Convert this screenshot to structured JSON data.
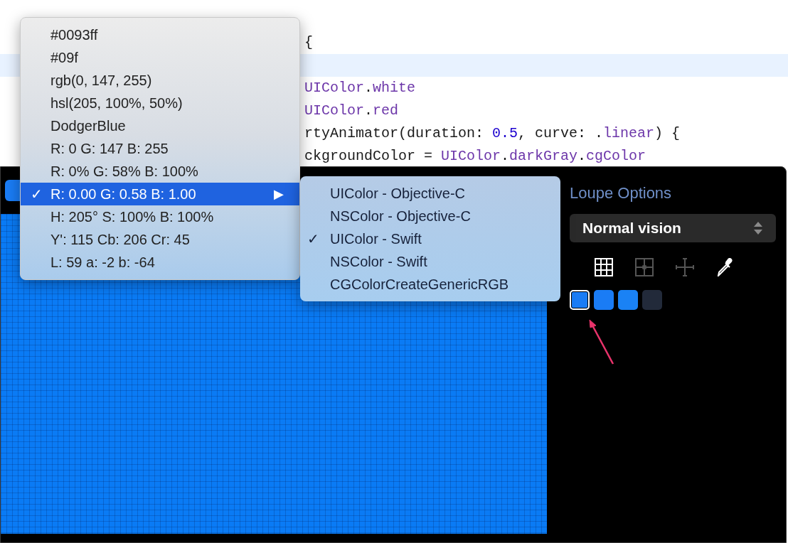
{
  "editor": {
    "lines": [
      {
        "highlighted": false,
        "tokens": [
          {
            "text": "{",
            "kind": "plain"
          }
        ]
      },
      {
        "highlighted": true
      },
      {
        "highlighted": false,
        "tokens": [
          {
            "text": "UIColor",
            "kind": "type"
          },
          {
            "text": ".",
            "kind": "plain"
          },
          {
            "text": "white",
            "kind": "type"
          }
        ]
      },
      {
        "highlighted": false,
        "tokens": [
          {
            "text": "UIColor",
            "kind": "type"
          },
          {
            "text": ".",
            "kind": "plain"
          },
          {
            "text": "red",
            "kind": "type"
          }
        ]
      },
      {
        "highlighted": false,
        "tokens": [
          {
            "text": "rtyAnimator(duration: ",
            "kind": "plain"
          },
          {
            "text": "0.5",
            "kind": "number"
          },
          {
            "text": ", curve: .",
            "kind": "plain"
          },
          {
            "text": "linear",
            "kind": "type"
          },
          {
            "text": ") {",
            "kind": "plain"
          }
        ]
      },
      {
        "highlighted": false,
        "tokens": [
          {
            "text": "ckgroundColor = ",
            "kind": "plain"
          },
          {
            "text": "UIColor",
            "kind": "type"
          },
          {
            "text": ".",
            "kind": "plain"
          },
          {
            "text": "darkGray",
            "kind": "type"
          },
          {
            "text": ".",
            "kind": "plain"
          },
          {
            "text": "cgColor",
            "kind": "type"
          }
        ]
      }
    ]
  },
  "format_menu": {
    "items": [
      {
        "label": "#0093ff",
        "selected": false,
        "submenu": false
      },
      {
        "label": "#09f",
        "selected": false,
        "submenu": false
      },
      {
        "label": "rgb(0, 147, 255)",
        "selected": false,
        "submenu": false
      },
      {
        "label": "hsl(205, 100%, 50%)",
        "selected": false,
        "submenu": false
      },
      {
        "label": "DodgerBlue",
        "selected": false,
        "submenu": false
      },
      {
        "label": "R: 0 G: 147 B: 255",
        "selected": false,
        "submenu": false
      },
      {
        "label": "R: 0% G: 58% B: 100%",
        "selected": false,
        "submenu": false
      },
      {
        "label": "R: 0.00 G: 0.58 B: 1.00",
        "selected": true,
        "submenu": true
      },
      {
        "label": "H: 205° S: 100% B: 100%",
        "selected": false,
        "submenu": false
      },
      {
        "label": "Y': 115 Cb: 206 Cr: 45",
        "selected": false,
        "submenu": false
      },
      {
        "label": "L: 59 a: -2 b: -64",
        "selected": false,
        "submenu": false
      }
    ],
    "check": "✓",
    "arrow": "▶"
  },
  "submenu": {
    "items": [
      {
        "label": "UIColor - Objective-C",
        "checked": false
      },
      {
        "label": "NSColor - Objective-C",
        "checked": false
      },
      {
        "label": "UIColor - Swift",
        "checked": true
      },
      {
        "label": "NSColor - Swift",
        "checked": false
      },
      {
        "label": "CGColorCreateGenericRGB",
        "checked": false
      }
    ],
    "check": "✓"
  },
  "loupe_options": {
    "title": "Loupe Options",
    "vision": "Normal vision",
    "tools": [
      {
        "kind": "grid",
        "active": true
      },
      {
        "kind": "quadrant",
        "active": false
      },
      {
        "kind": "crosshair",
        "active": false
      },
      {
        "kind": "eyedropper",
        "active": true
      }
    ],
    "swatches": [
      {
        "color": "#1a7cf5",
        "selected": true
      },
      {
        "color": "#1a7cf5",
        "selected": false
      },
      {
        "color": "#1a82f5",
        "selected": false
      },
      {
        "color": "#222a3a",
        "selected": false
      }
    ]
  }
}
